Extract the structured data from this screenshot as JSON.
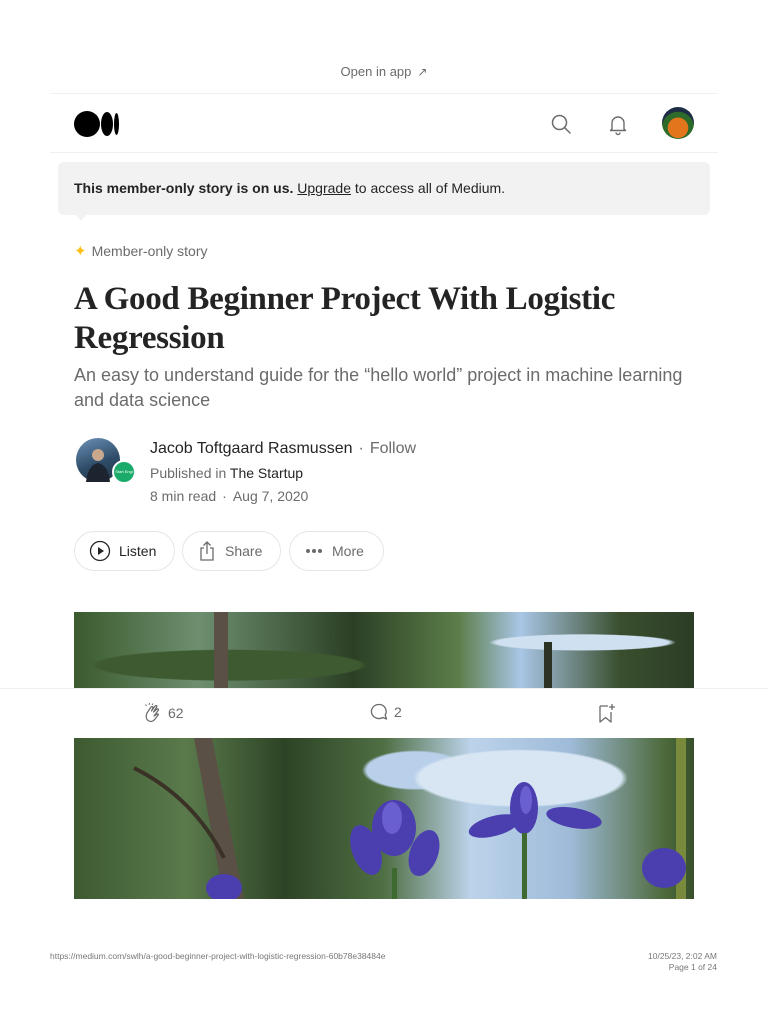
{
  "header": {
    "open_in_app": "Open in app",
    "open_in_app_arrow": "↗"
  },
  "banner": {
    "bold": "This member-only story is on us.",
    "link": "Upgrade",
    "rest": "to access all of Medium."
  },
  "article": {
    "member_label": "Member-only story",
    "title": "A Good Beginner Project With Logistic Regression",
    "subtitle": "An easy to understand guide for the “hello world” project in machine learning and data science",
    "author": {
      "name": "Jacob Toftgaard Rasmussen",
      "follow": "Follow",
      "published_prefix": "Published in",
      "publication": "The Startup",
      "read_time": "8 min read",
      "date": "Aug 7, 2020",
      "badge_text": "Start Engl"
    }
  },
  "actions": {
    "listen": "Listen",
    "share": "Share",
    "more": "More"
  },
  "engagement": {
    "claps": "62",
    "comments": "2"
  },
  "footer": {
    "url": "https://medium.com/swlh/a-good-beginner-project-with-logistic-regression-60b78e38484e",
    "datetime": "10/25/23, 2:02 AM",
    "page": "Page 1 of 24"
  },
  "colors": {
    "accent_star": "#ffc017",
    "publication_badge": "#1aab6a",
    "text_primary": "#242424",
    "text_muted": "#6b6b6b"
  }
}
